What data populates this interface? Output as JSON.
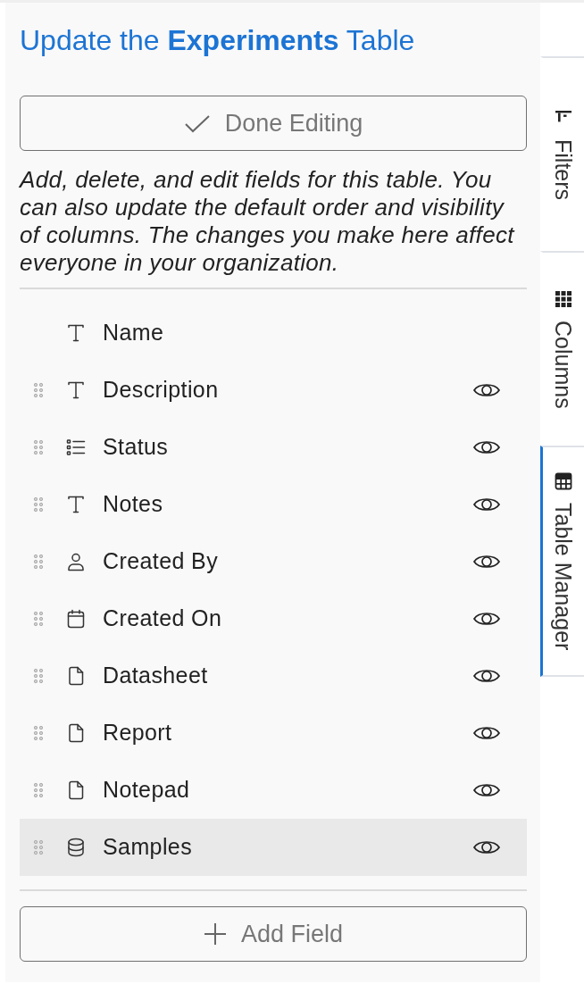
{
  "panel": {
    "title": "Update the **Experiments** Table",
    "done_button": {
      "label": "Done Editing"
    },
    "description": "Add, delete, and edit fields for this table. You can also update the default order and visibility of columns. The changes you make here affect everyone in your organization.",
    "fields": [
      {
        "label": "Name",
        "kind": "text",
        "draggable": false,
        "selected": false
      },
      {
        "label": "Description",
        "kind": "text",
        "draggable": true,
        "visible": true,
        "selected": false
      },
      {
        "label": "Status",
        "kind": "list",
        "draggable": true,
        "visible": true,
        "selected": false
      },
      {
        "label": "Notes",
        "kind": "text",
        "draggable": true,
        "visible": true,
        "selected": false
      },
      {
        "label": "Created By",
        "kind": "user",
        "draggable": true,
        "visible": true,
        "selected": false
      },
      {
        "label": "Created On",
        "kind": "date",
        "draggable": true,
        "visible": true,
        "selected": false
      },
      {
        "label": "Datasheet",
        "kind": "file",
        "draggable": true,
        "visible": true,
        "selected": false
      },
      {
        "label": "Report",
        "kind": "file",
        "draggable": true,
        "visible": true,
        "selected": false
      },
      {
        "label": "Notepad",
        "kind": "file",
        "draggable": true,
        "visible": true,
        "selected": false
      },
      {
        "label": "Samples",
        "kind": "database",
        "draggable": true,
        "visible": true,
        "selected": true
      }
    ],
    "add_button": {
      "label": "Add Field"
    }
  },
  "side_tabs": [
    {
      "label": "Filters",
      "kind": "filters",
      "selected": false
    },
    {
      "label": "Columns",
      "kind": "columns",
      "selected": false
    },
    {
      "label": "Table Manager",
      "kind": "table",
      "selected": true
    }
  ]
}
